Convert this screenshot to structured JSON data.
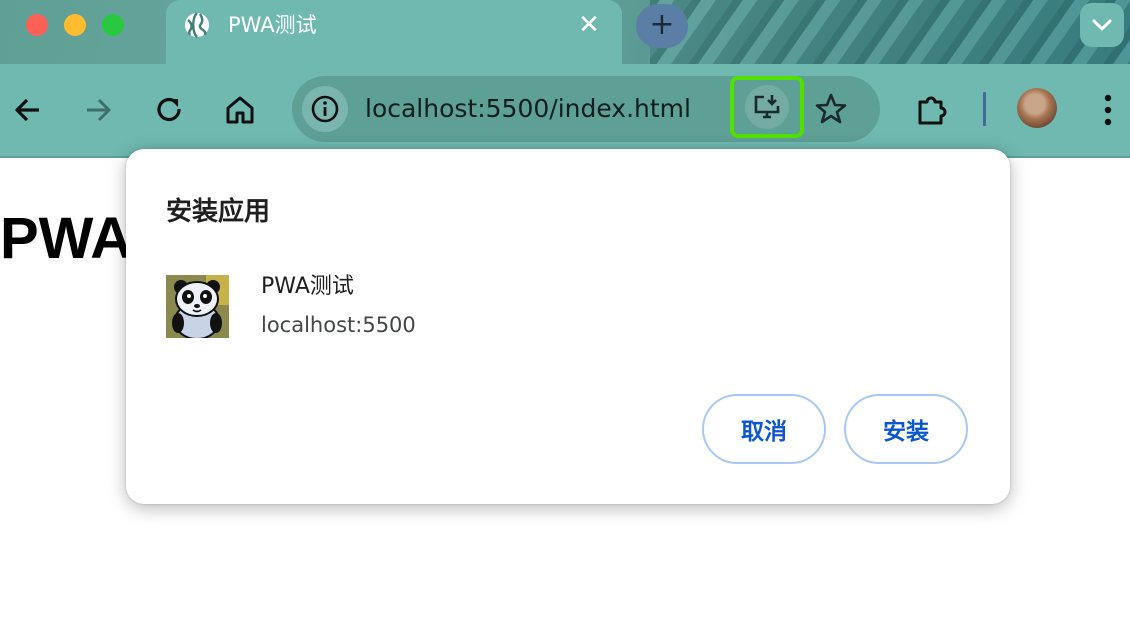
{
  "tab": {
    "title": "PWA测试",
    "close_glyph": "✕",
    "icon": "globe-icon"
  },
  "new_tab": {
    "glyph": "+"
  },
  "toolbar": {
    "back_icon": "arrow-left-icon",
    "forward_icon": "arrow-right-icon",
    "reload_icon": "reload-icon",
    "home_icon": "home-icon",
    "url": "localhost:5500/index.html",
    "install_icon": "install-app-icon",
    "bookmark_icon": "star-icon",
    "extensions_icon": "puzzle-icon",
    "menu_icon": "kebab-menu-icon",
    "highlight_color": "#52e000"
  },
  "page": {
    "heading": "PWA"
  },
  "dialog": {
    "title": "安装应用",
    "app_name": "PWA测试",
    "app_origin": "localhost:5500",
    "cancel_label": "取消",
    "install_label": "安装",
    "accent_color": "#0b57d0"
  }
}
